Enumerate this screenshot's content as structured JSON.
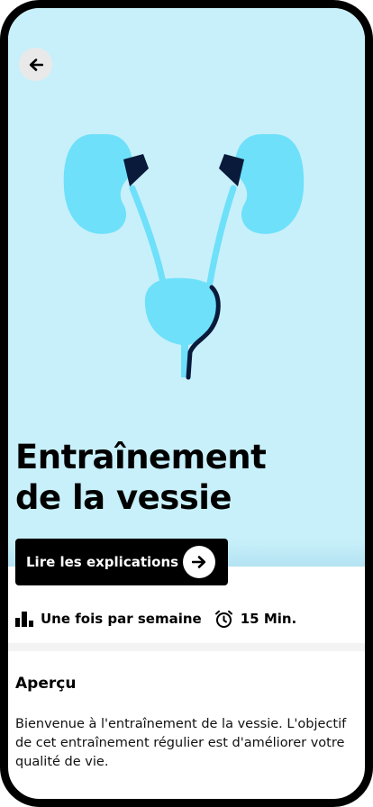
{
  "header": {
    "back_icon": "arrow-left-icon"
  },
  "hero": {
    "title_line1": "Entraînement",
    "title_line2": "de la vessie",
    "illustration": "kidneys-bladder-illustration",
    "background_color": "#c8f0fa",
    "organ_color": "#6ee0fa",
    "accent_color": "#0a1a3a"
  },
  "cta": {
    "label": "Lire les explications",
    "icon": "arrow-right-icon"
  },
  "meta": {
    "frequency_icon": "bar-chart-icon",
    "frequency": "Une fois par semaine",
    "duration_icon": "alarm-clock-icon",
    "duration": "15 Min."
  },
  "overview": {
    "title": "Aperçu",
    "body": "Bienvenue à l'entraînement de la vessie. L'objectif de cet entraînement régulier est d'améliorer votre qualité de vie."
  }
}
